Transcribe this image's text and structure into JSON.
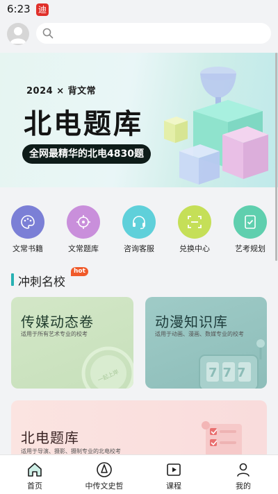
{
  "status": {
    "time": "6:23",
    "app_badge": "迪"
  },
  "search": {
    "placeholder": ""
  },
  "banner": {
    "year_line": "2024 × 背文常",
    "title": "北电题库",
    "pill": "全网最精华的北电4830题"
  },
  "menu": {
    "items": [
      {
        "label": "文常书籍",
        "icon": "palette-icon",
        "color": "#7b7fd6"
      },
      {
        "label": "文常题库",
        "icon": "target-icon",
        "color": "#c98fdb"
      },
      {
        "label": "咨询客服",
        "icon": "headset-icon",
        "color": "#5fd0da"
      },
      {
        "label": "兑换中心",
        "icon": "scan-icon",
        "color": "#c5df58"
      },
      {
        "label": "艺考规划",
        "icon": "checklist-icon",
        "color": "#5fcfae"
      }
    ]
  },
  "section": {
    "title": "冲刺名校",
    "badge": "hot"
  },
  "cards": {
    "media": {
      "title": "传媒动态卷",
      "subtitle": "适用于所有艺术专业的校考",
      "stamp": "一起上岸"
    },
    "anime": {
      "title": "动漫知识库",
      "subtitle": "适用于动画、漫画、数媒专业的校考",
      "digits": "777"
    },
    "bd": {
      "title": "北电题库",
      "subtitle": "适用于导演、摄影、摄制专业的北电校考"
    }
  },
  "nav": {
    "tabs": [
      {
        "label": "首页",
        "icon": "home-icon",
        "active": true
      },
      {
        "label": "中传文史哲",
        "icon": "compass-icon",
        "active": false
      },
      {
        "label": "课程",
        "icon": "play-icon",
        "active": false
      },
      {
        "label": "我的",
        "icon": "user-icon",
        "active": false
      }
    ]
  },
  "colors": {
    "accent": "#27b1b3",
    "hot": "#f05a2a"
  }
}
